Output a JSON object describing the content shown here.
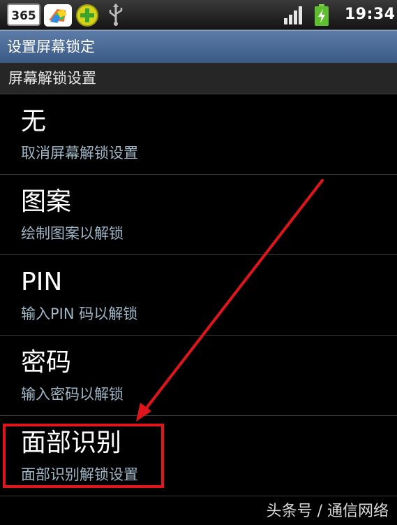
{
  "status_bar": {
    "app_badge": "365",
    "time": "19:34",
    "icons": [
      "app-365-icon",
      "colorful-app-icon",
      "plus-app-icon",
      "usb-icon",
      "signal-icon",
      "battery-charging-icon"
    ]
  },
  "title_bar": {
    "title": "设置屏幕锁定"
  },
  "section": {
    "header": "屏幕解锁设置"
  },
  "options": [
    {
      "title": "无",
      "subtitle": "取消屏幕解锁设置"
    },
    {
      "title": "图案",
      "subtitle": "绘制图案以解锁"
    },
    {
      "title": "PIN",
      "subtitle": "输入PIN 码以解锁"
    },
    {
      "title": "密码",
      "subtitle": "输入密码以解锁"
    },
    {
      "title": "面部识别",
      "subtitle": "面部识别解锁设置"
    }
  ],
  "annotation": {
    "highlight_color": "#e0151b",
    "arrow_color": "#e0151b"
  },
  "watermark": {
    "text": "头条号 / 通信网络"
  },
  "colors": {
    "title_bar": "#4a6b97",
    "subtitle_text": "#9fb6c6",
    "background": "#000000"
  }
}
